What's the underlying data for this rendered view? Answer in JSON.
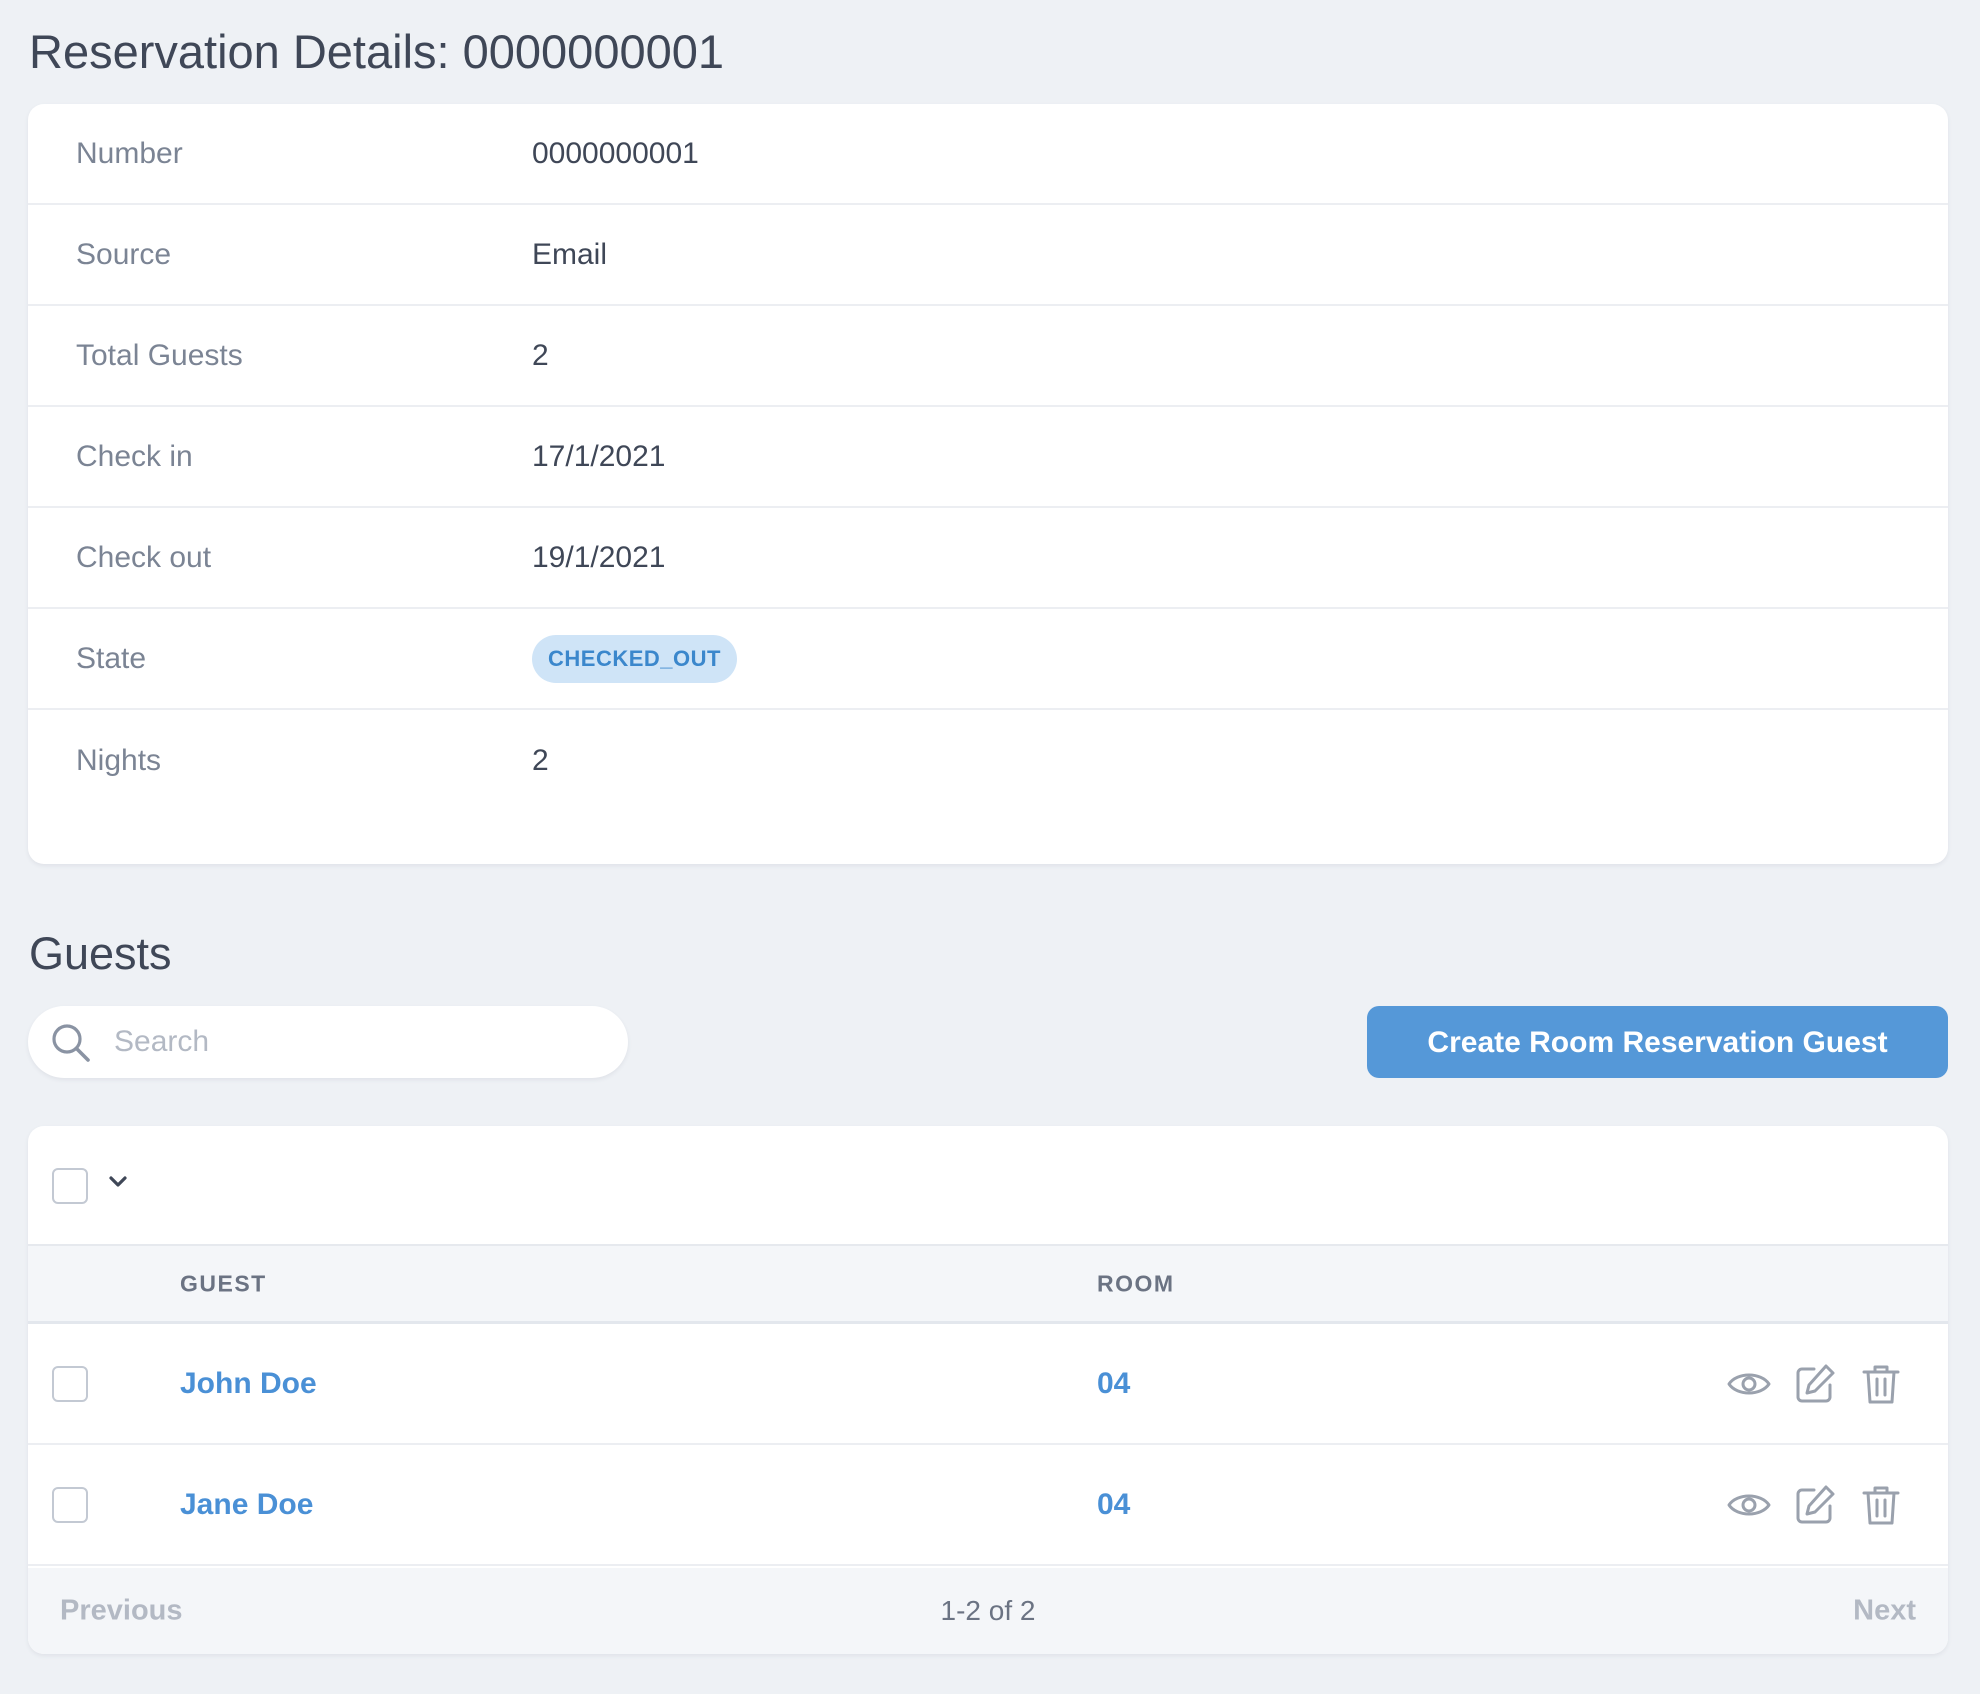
{
  "page": {
    "title": "Reservation Details: 0000000001"
  },
  "details": [
    {
      "label": "Number",
      "value": "0000000001"
    },
    {
      "label": "Source",
      "value": "Email"
    },
    {
      "label": "Total Guests",
      "value": "2"
    },
    {
      "label": "Check in",
      "value": "17/1/2021"
    },
    {
      "label": "Check out",
      "value": "19/1/2021"
    },
    {
      "label": "State",
      "value": "CHECKED_OUT"
    },
    {
      "label": "Nights",
      "value": "2"
    }
  ],
  "guests_section": {
    "title": "Guests",
    "search": {
      "placeholder": "Search",
      "value": ""
    },
    "create_button_label": "Create Room Reservation Guest"
  },
  "table": {
    "columns": [
      "GUEST",
      "ROOM"
    ],
    "rows": [
      {
        "guest": "John Doe",
        "room": "04"
      },
      {
        "guest": "Jane Doe",
        "room": "04"
      }
    ],
    "row_actions": [
      "eye-icon",
      "edit-icon",
      "trash-icon"
    ]
  },
  "pagination": {
    "previous_label": "Previous",
    "status": "1-2 of 2",
    "next_label": "Next"
  },
  "colors": {
    "background": "#eef1f5",
    "accent": "#5598d8",
    "link": "#4a90d6",
    "badge_bg": "#cfe4f7",
    "badge_text": "#3b87cc"
  }
}
